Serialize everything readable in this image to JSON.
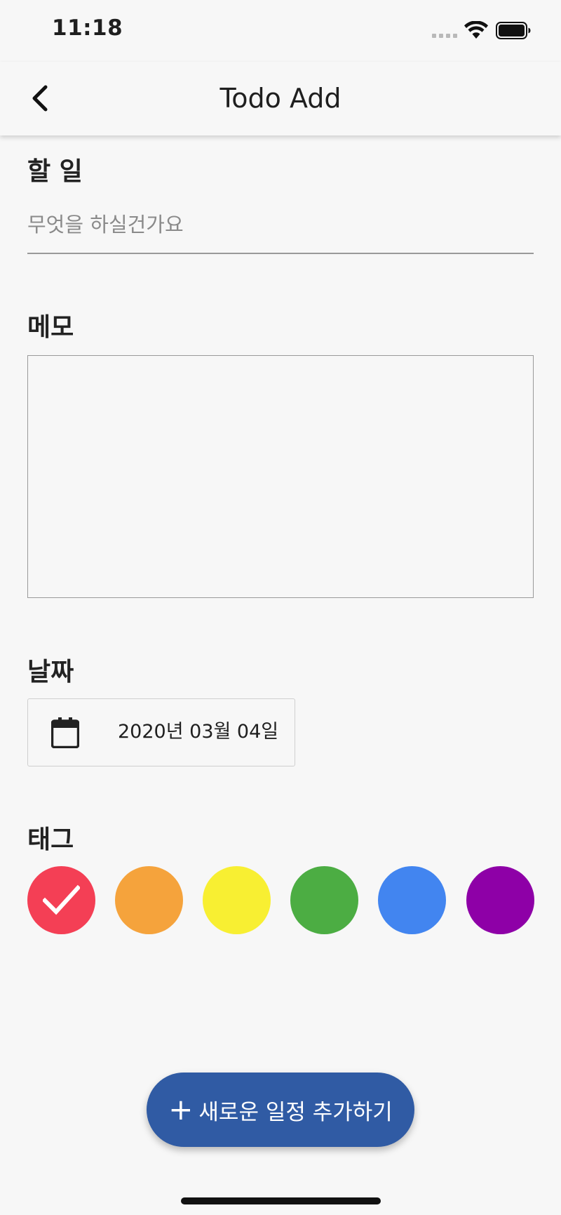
{
  "status_bar": {
    "time": "11:18"
  },
  "nav": {
    "title": "Todo Add"
  },
  "todo": {
    "label": "할 일",
    "placeholder": "무엇을 하실건가요",
    "value": ""
  },
  "memo": {
    "label": "메모",
    "value": ""
  },
  "date": {
    "label": "날짜",
    "value": "2020년 03월 04일"
  },
  "tags": {
    "label": "태그",
    "items": [
      {
        "color": "#f43f55",
        "selected": true
      },
      {
        "color": "#f5a33c",
        "selected": false
      },
      {
        "color": "#f8ef32",
        "selected": false
      },
      {
        "color": "#4cad43",
        "selected": false
      },
      {
        "color": "#4285f0",
        "selected": false
      },
      {
        "color": "#8e00a7",
        "selected": false
      }
    ]
  },
  "add_button": {
    "icon": "plus-icon",
    "label": "새로운 일정 추가하기",
    "color": "#305ba4"
  }
}
